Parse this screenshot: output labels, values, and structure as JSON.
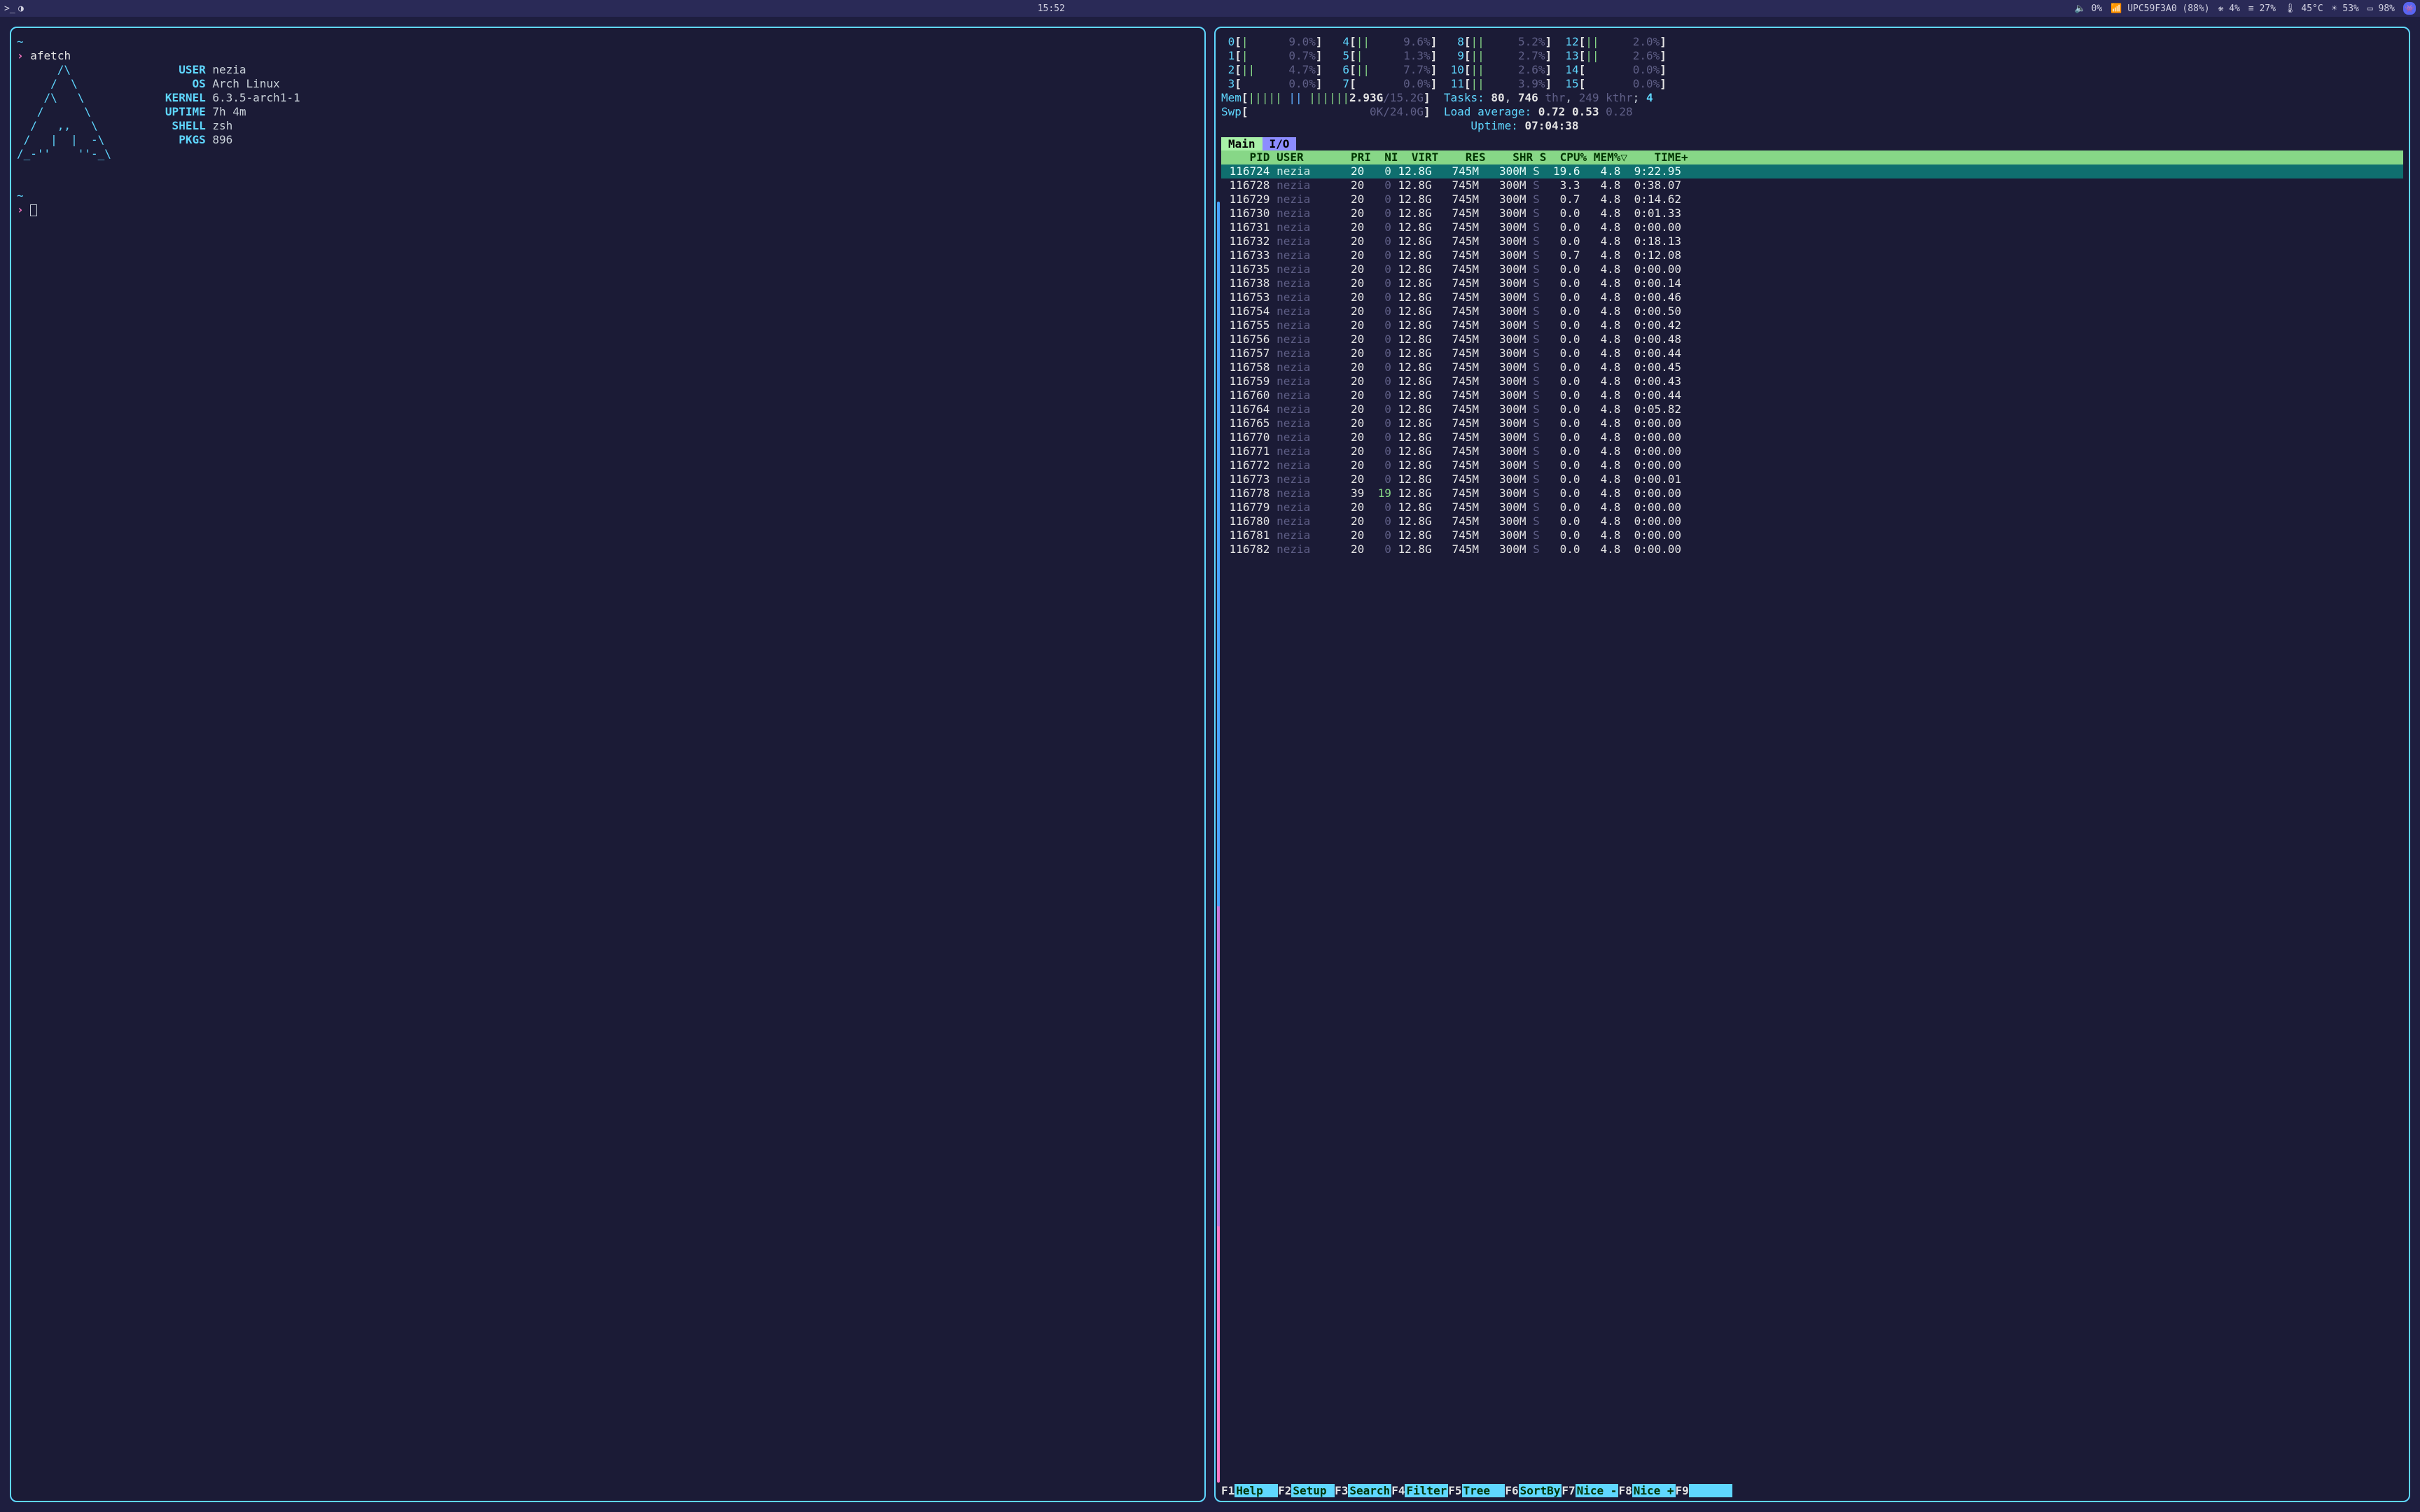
{
  "topbar": {
    "clock": "15:52",
    "volume_pct": "0%",
    "wifi": "UPC59F3A0 (88%)",
    "gear_pct": "4%",
    "lines_pct": "27%",
    "temp": "45°C",
    "fan_pct": "53%",
    "battery_pct": "98%"
  },
  "afetch": {
    "cmd": "afetch",
    "art": [
      "      /\\",
      "     /  \\",
      "    /\\   \\",
      "   /      \\",
      "  /   ,,   \\",
      " /   |  |  -\\",
      "/_-''    ''-_\\"
    ],
    "fields": [
      {
        "label": "USER",
        "value": "nezia"
      },
      {
        "label": "OS",
        "value": "Arch Linux"
      },
      {
        "label": "KERNEL",
        "value": "6.3.5-arch1-1"
      },
      {
        "label": "UPTIME",
        "value": "7h 4m"
      },
      {
        "label": "SHELL",
        "value": "zsh"
      },
      {
        "label": "PKGS",
        "value": "896"
      }
    ]
  },
  "htop": {
    "cpus": [
      {
        "n": 0,
        "bar": "|",
        "pct": "9.0%"
      },
      {
        "n": 1,
        "bar": "|",
        "pct": "0.7%"
      },
      {
        "n": 2,
        "bar": "||",
        "pct": "4.7%"
      },
      {
        "n": 3,
        "bar": "",
        "pct": "0.0%"
      },
      {
        "n": 4,
        "bar": "||",
        "pct": "9.6%"
      },
      {
        "n": 5,
        "bar": "|",
        "pct": "1.3%"
      },
      {
        "n": 6,
        "bar": "||",
        "pct": "7.7%"
      },
      {
        "n": 7,
        "bar": "",
        "pct": "0.0%"
      },
      {
        "n": 8,
        "bar": "||",
        "pct": "5.2%"
      },
      {
        "n": 9,
        "bar": "||",
        "pct": "2.7%"
      },
      {
        "n": 10,
        "bar": "||",
        "pct": "2.6%"
      },
      {
        "n": 11,
        "bar": "||",
        "pct": "3.9%"
      },
      {
        "n": 12,
        "bar": "||",
        "pct": "2.0%"
      },
      {
        "n": 13,
        "bar": "||",
        "pct": "2.6%"
      },
      {
        "n": 14,
        "bar": "",
        "pct": "0.0%"
      },
      {
        "n": 15,
        "bar": "",
        "pct": "0.0%"
      }
    ],
    "mem": {
      "used": "2.93G",
      "total": "15.2G"
    },
    "swap": {
      "used": "0K",
      "total": "24.0G"
    },
    "tasks": {
      "procs": "80",
      "threads": "746",
      "kthreads": "249",
      "running": "4"
    },
    "loadavg": [
      "0.72",
      "0.53",
      "0.28"
    ],
    "uptime": "07:04:38",
    "tabs": {
      "main": "Main",
      "io": "I/O"
    },
    "header": " PID USER       PRI  NI  VIRT   RES   SHR S  CPU% MEM%▽   TIME+",
    "procs": [
      {
        "pid": "116724",
        "user": "nezia",
        "pri": "20",
        "ni": "0",
        "virt": "12.8G",
        "res": "745M",
        "shr": "300M",
        "s": "S",
        "cpu": "19.6",
        "mem": "4.8",
        "time": "9:22.95",
        "sel": true
      },
      {
        "pid": "116728",
        "user": "nezia",
        "pri": "20",
        "ni": "0",
        "virt": "12.8G",
        "res": "745M",
        "shr": "300M",
        "s": "S",
        "cpu": "3.3",
        "mem": "4.8",
        "time": "0:38.07"
      },
      {
        "pid": "116729",
        "user": "nezia",
        "pri": "20",
        "ni": "0",
        "virt": "12.8G",
        "res": "745M",
        "shr": "300M",
        "s": "S",
        "cpu": "0.7",
        "mem": "4.8",
        "time": "0:14.62"
      },
      {
        "pid": "116730",
        "user": "nezia",
        "pri": "20",
        "ni": "0",
        "virt": "12.8G",
        "res": "745M",
        "shr": "300M",
        "s": "S",
        "cpu": "0.0",
        "mem": "4.8",
        "time": "0:01.33"
      },
      {
        "pid": "116731",
        "user": "nezia",
        "pri": "20",
        "ni": "0",
        "virt": "12.8G",
        "res": "745M",
        "shr": "300M",
        "s": "S",
        "cpu": "0.0",
        "mem": "4.8",
        "time": "0:00.00"
      },
      {
        "pid": "116732",
        "user": "nezia",
        "pri": "20",
        "ni": "0",
        "virt": "12.8G",
        "res": "745M",
        "shr": "300M",
        "s": "S",
        "cpu": "0.0",
        "mem": "4.8",
        "time": "0:18.13"
      },
      {
        "pid": "116733",
        "user": "nezia",
        "pri": "20",
        "ni": "0",
        "virt": "12.8G",
        "res": "745M",
        "shr": "300M",
        "s": "S",
        "cpu": "0.7",
        "mem": "4.8",
        "time": "0:12.08"
      },
      {
        "pid": "116735",
        "user": "nezia",
        "pri": "20",
        "ni": "0",
        "virt": "12.8G",
        "res": "745M",
        "shr": "300M",
        "s": "S",
        "cpu": "0.0",
        "mem": "4.8",
        "time": "0:00.00"
      },
      {
        "pid": "116738",
        "user": "nezia",
        "pri": "20",
        "ni": "0",
        "virt": "12.8G",
        "res": "745M",
        "shr": "300M",
        "s": "S",
        "cpu": "0.0",
        "mem": "4.8",
        "time": "0:00.14"
      },
      {
        "pid": "116753",
        "user": "nezia",
        "pri": "20",
        "ni": "0",
        "virt": "12.8G",
        "res": "745M",
        "shr": "300M",
        "s": "S",
        "cpu": "0.0",
        "mem": "4.8",
        "time": "0:00.46"
      },
      {
        "pid": "116754",
        "user": "nezia",
        "pri": "20",
        "ni": "0",
        "virt": "12.8G",
        "res": "745M",
        "shr": "300M",
        "s": "S",
        "cpu": "0.0",
        "mem": "4.8",
        "time": "0:00.50"
      },
      {
        "pid": "116755",
        "user": "nezia",
        "pri": "20",
        "ni": "0",
        "virt": "12.8G",
        "res": "745M",
        "shr": "300M",
        "s": "S",
        "cpu": "0.0",
        "mem": "4.8",
        "time": "0:00.42"
      },
      {
        "pid": "116756",
        "user": "nezia",
        "pri": "20",
        "ni": "0",
        "virt": "12.8G",
        "res": "745M",
        "shr": "300M",
        "s": "S",
        "cpu": "0.0",
        "mem": "4.8",
        "time": "0:00.48"
      },
      {
        "pid": "116757",
        "user": "nezia",
        "pri": "20",
        "ni": "0",
        "virt": "12.8G",
        "res": "745M",
        "shr": "300M",
        "s": "S",
        "cpu": "0.0",
        "mem": "4.8",
        "time": "0:00.44"
      },
      {
        "pid": "116758",
        "user": "nezia",
        "pri": "20",
        "ni": "0",
        "virt": "12.8G",
        "res": "745M",
        "shr": "300M",
        "s": "S",
        "cpu": "0.0",
        "mem": "4.8",
        "time": "0:00.45"
      },
      {
        "pid": "116759",
        "user": "nezia",
        "pri": "20",
        "ni": "0",
        "virt": "12.8G",
        "res": "745M",
        "shr": "300M",
        "s": "S",
        "cpu": "0.0",
        "mem": "4.8",
        "time": "0:00.43"
      },
      {
        "pid": "116760",
        "user": "nezia",
        "pri": "20",
        "ni": "0",
        "virt": "12.8G",
        "res": "745M",
        "shr": "300M",
        "s": "S",
        "cpu": "0.0",
        "mem": "4.8",
        "time": "0:00.44"
      },
      {
        "pid": "116764",
        "user": "nezia",
        "pri": "20",
        "ni": "0",
        "virt": "12.8G",
        "res": "745M",
        "shr": "300M",
        "s": "S",
        "cpu": "0.0",
        "mem": "4.8",
        "time": "0:05.82"
      },
      {
        "pid": "116765",
        "user": "nezia",
        "pri": "20",
        "ni": "0",
        "virt": "12.8G",
        "res": "745M",
        "shr": "300M",
        "s": "S",
        "cpu": "0.0",
        "mem": "4.8",
        "time": "0:00.00"
      },
      {
        "pid": "116770",
        "user": "nezia",
        "pri": "20",
        "ni": "0",
        "virt": "12.8G",
        "res": "745M",
        "shr": "300M",
        "s": "S",
        "cpu": "0.0",
        "mem": "4.8",
        "time": "0:00.00"
      },
      {
        "pid": "116771",
        "user": "nezia",
        "pri": "20",
        "ni": "0",
        "virt": "12.8G",
        "res": "745M",
        "shr": "300M",
        "s": "S",
        "cpu": "0.0",
        "mem": "4.8",
        "time": "0:00.00"
      },
      {
        "pid": "116772",
        "user": "nezia",
        "pri": "20",
        "ni": "0",
        "virt": "12.8G",
        "res": "745M",
        "shr": "300M",
        "s": "S",
        "cpu": "0.0",
        "mem": "4.8",
        "time": "0:00.00"
      },
      {
        "pid": "116773",
        "user": "nezia",
        "pri": "20",
        "ni": "0",
        "virt": "12.8G",
        "res": "745M",
        "shr": "300M",
        "s": "S",
        "cpu": "0.0",
        "mem": "4.8",
        "time": "0:00.01"
      },
      {
        "pid": "116778",
        "user": "nezia",
        "pri": "39",
        "ni": "19",
        "virt": "12.8G",
        "res": "745M",
        "shr": "300M",
        "s": "S",
        "cpu": "0.0",
        "mem": "4.8",
        "time": "0:00.00"
      },
      {
        "pid": "116779",
        "user": "nezia",
        "pri": "20",
        "ni": "0",
        "virt": "12.8G",
        "res": "745M",
        "shr": "300M",
        "s": "S",
        "cpu": "0.0",
        "mem": "4.8",
        "time": "0:00.00"
      },
      {
        "pid": "116780",
        "user": "nezia",
        "pri": "20",
        "ni": "0",
        "virt": "12.8G",
        "res": "745M",
        "shr": "300M",
        "s": "S",
        "cpu": "0.0",
        "mem": "4.8",
        "time": "0:00.00"
      },
      {
        "pid": "116781",
        "user": "nezia",
        "pri": "20",
        "ni": "0",
        "virt": "12.8G",
        "res": "745M",
        "shr": "300M",
        "s": "S",
        "cpu": "0.0",
        "mem": "4.8",
        "time": "0:00.00"
      },
      {
        "pid": "116782",
        "user": "nezia",
        "pri": "20",
        "ni": "0",
        "virt": "12.8G",
        "res": "745M",
        "shr": "300M",
        "s": "S",
        "cpu": "0.0",
        "mem": "4.8",
        "time": "0:00.00"
      }
    ],
    "fkeys": [
      {
        "key": "F1",
        "label": "Help"
      },
      {
        "key": "F2",
        "label": "Setup"
      },
      {
        "key": "F3",
        "label": "Search"
      },
      {
        "key": "F4",
        "label": "Filter"
      },
      {
        "key": "F5",
        "label": "Tree"
      },
      {
        "key": "F6",
        "label": "SortBy"
      },
      {
        "key": "F7",
        "label": "Nice -"
      },
      {
        "key": "F8",
        "label": "Nice +"
      },
      {
        "key": "F9",
        "label": ""
      }
    ]
  }
}
